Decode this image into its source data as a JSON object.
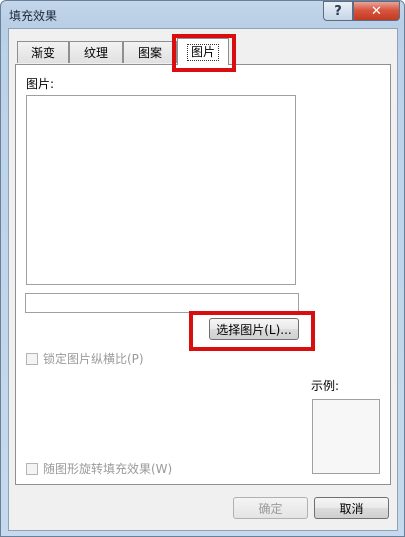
{
  "window": {
    "title": "填充效果",
    "help_label": "?",
    "close_label": "✕"
  },
  "tabs": [
    {
      "label": "渐变"
    },
    {
      "label": "纹理"
    },
    {
      "label": "图案"
    },
    {
      "label": "图片",
      "active": true
    }
  ],
  "picture_tab": {
    "picture_label": "图片:",
    "filename_value": "",
    "select_button_label": "选择图片(L)...",
    "lock_ratio_label": "锁定图片纵横比(P)",
    "lock_ratio_checked": false,
    "sample_label": "示例:",
    "rotate_label": "随图形旋转填充效果(W)",
    "rotate_checked": false
  },
  "footer": {
    "ok_label": "确定",
    "cancel_label": "取消"
  },
  "annotation_color": "#d90f0f"
}
